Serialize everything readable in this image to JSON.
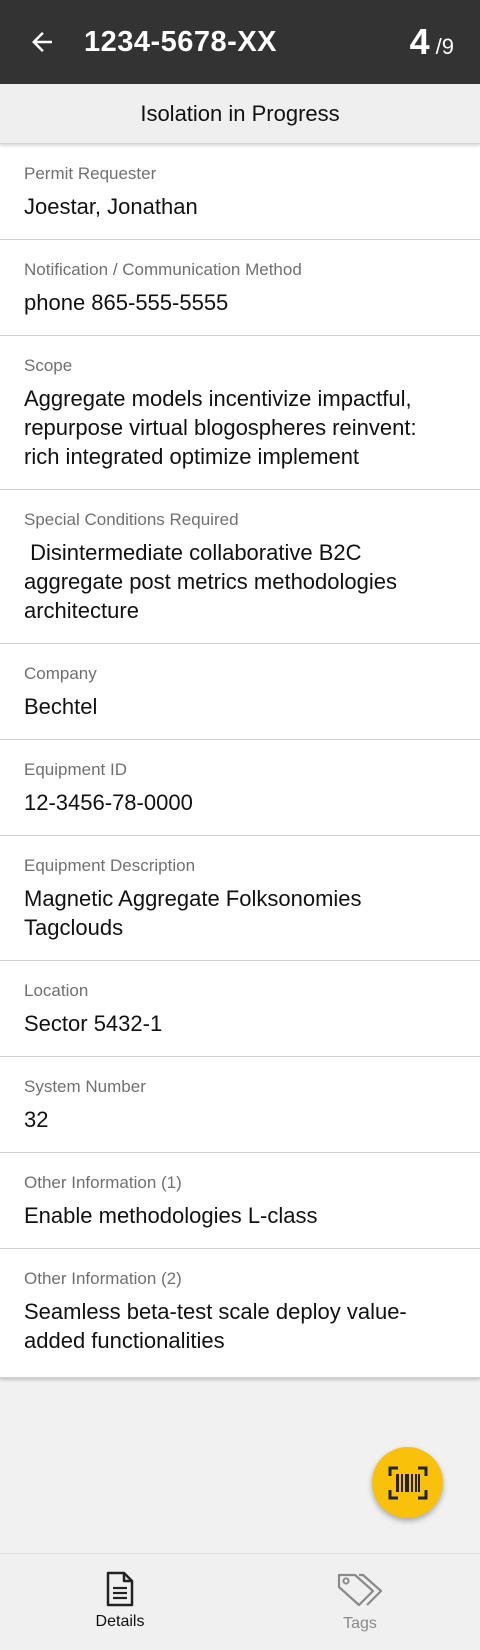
{
  "appbar": {
    "title": "1234-5678-XX",
    "current_index": "4",
    "separator": "/",
    "total": "9"
  },
  "status": "Isolation in Progress",
  "fields": [
    {
      "label": "Permit Requester",
      "value": "Joestar, Jonathan"
    },
    {
      "label": "Notification / Communication Method",
      "value": "phone 865-555-5555"
    },
    {
      "label": "Scope",
      "value": "Aggregate models incentivize impactful, repurpose virtual blogospheres reinvent: rich integrated optimize implement"
    },
    {
      "label": "Special Conditions Required",
      "value": " Disintermediate collaborative B2C aggregate post metrics methodologies architecture"
    },
    {
      "label": "Company",
      "value": "Bechtel"
    },
    {
      "label": "Equipment ID",
      "value": "12-3456-78-0000"
    },
    {
      "label": "Equipment Description",
      "value": "Magnetic Aggregate Folksonomies Tagclouds"
    },
    {
      "label": "Location",
      "value": "Sector 5432-1"
    },
    {
      "label": "System Number",
      "value": "32"
    },
    {
      "label": "Other Information (1)",
      "value": "Enable methodologies L-class"
    },
    {
      "label": "Other Information (2)",
      "value": "Seamless beta-test scale deploy value-added functionalities"
    }
  ],
  "fab": {
    "icon": "barcode-scan-icon",
    "color": "#f9c10a"
  },
  "bottom_nav": {
    "items": [
      {
        "label": "Details",
        "icon": "document-icon",
        "active": true
      },
      {
        "label": "Tags",
        "icon": "tags-icon",
        "active": false
      }
    ]
  },
  "colors": {
    "appbar": "#333333",
    "accent": "#f9c10a"
  }
}
